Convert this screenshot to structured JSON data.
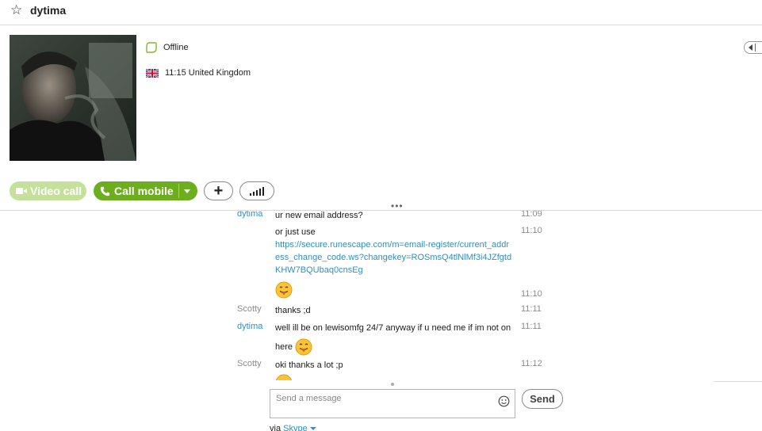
{
  "header": {
    "contact_name": "dytima",
    "star_icon": "star-icon"
  },
  "profile": {
    "status_text": "Offline",
    "status_icon": "offline-status-icon",
    "local_time": "11:15 United Kingdom",
    "flag_icon": "uk-flag-icon"
  },
  "actions": {
    "video_call_label": "Video call",
    "call_mobile_label": "Call mobile",
    "add_icon": "plus-icon",
    "signal_icon": "call-quality-icon"
  },
  "colors": {
    "accent_green": "#6dae1f",
    "disabled_green": "#c5e09a",
    "link_blue": "#2f8fc6"
  },
  "messages": [
    {
      "sender": "dytima",
      "text": "ur new email address?",
      "time": "11:09"
    },
    {
      "sender": "",
      "text": "or just use",
      "link": "https://secure.runescape.com/m=email-register/current_address_change_code.ws?changekey=ROSmsQ4tlNlMf3i4JZfgtdKHW7BQUbaq0cnsEg",
      "time": "11:10"
    },
    {
      "sender": "",
      "text": "",
      "emoji": "tongue-out-emoji",
      "time": "11:10"
    },
    {
      "sender": "Scotty",
      "text": "thanks ;d",
      "time": "11:11"
    },
    {
      "sender": "dytima",
      "text": "well ill be on lewisomfg 24/7 anyway if u need me if im not on here",
      "emoji": "tongue-out-emoji",
      "time": "11:11"
    },
    {
      "sender": "Scotty",
      "text": "oki thanks a lot ;p",
      "time": "11:12"
    }
  ],
  "composer": {
    "placeholder": "Send a message",
    "send_label": "Send",
    "via_prefix": "via",
    "via_service": "Skype"
  }
}
